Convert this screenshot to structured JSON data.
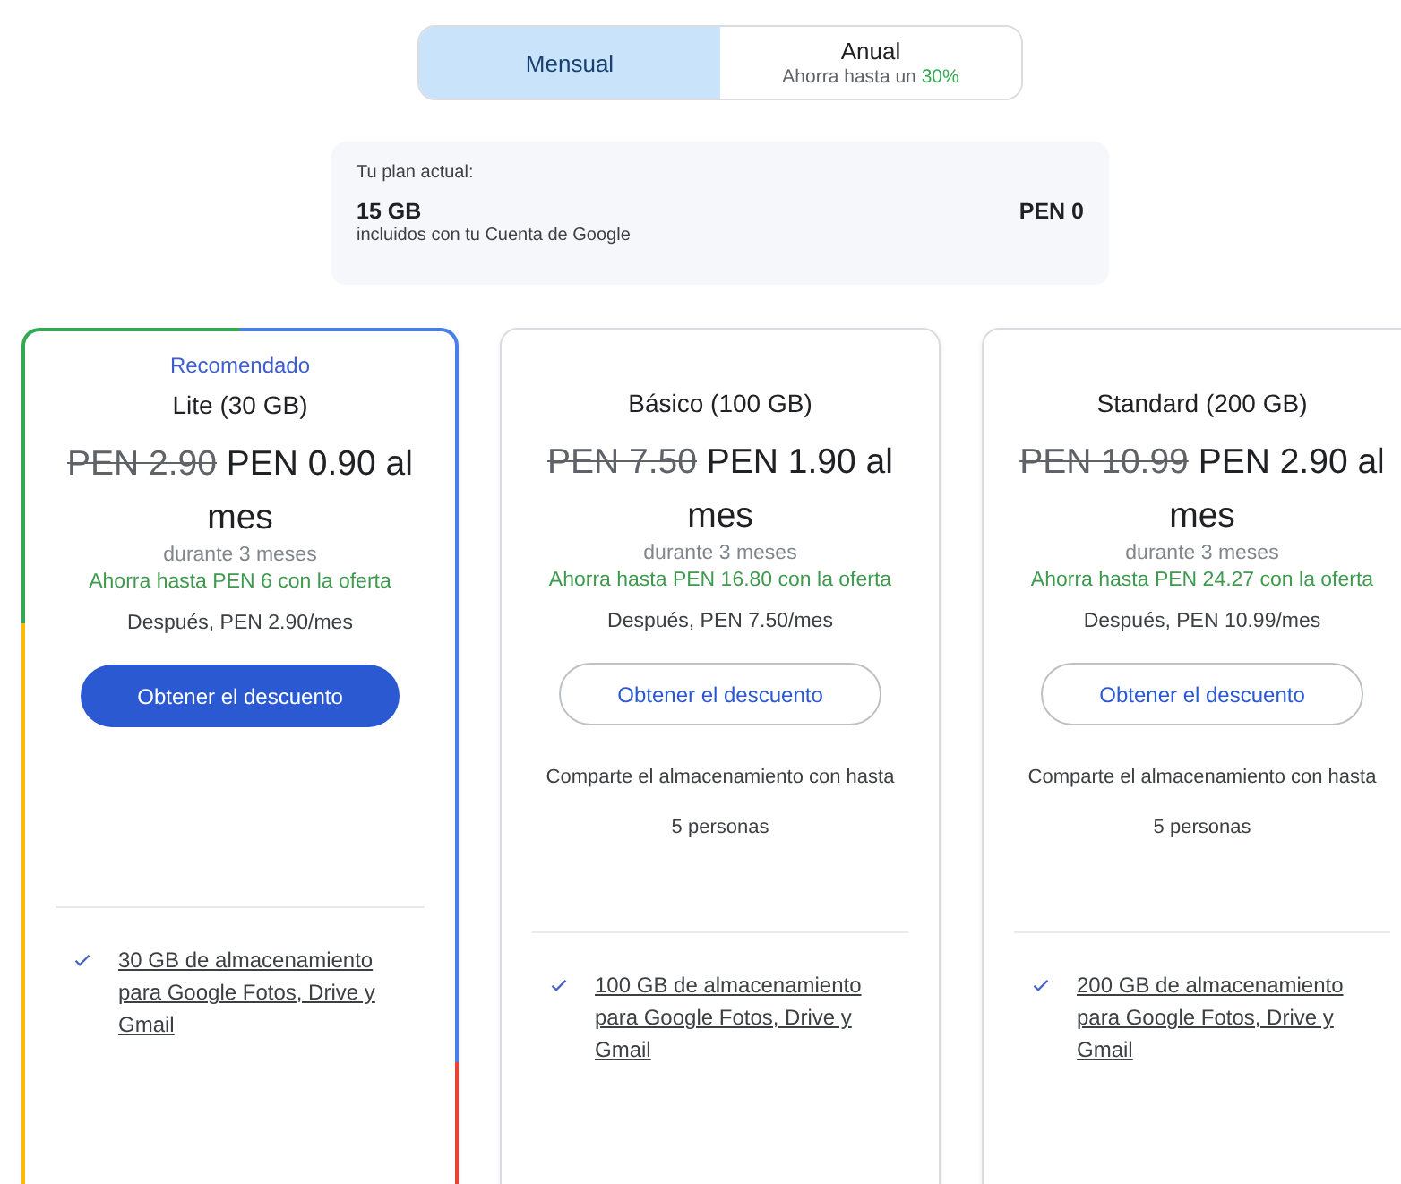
{
  "billing_toggle": [
    {
      "label": "Mensual",
      "selected": true
    },
    {
      "label": "Anual",
      "selected": false,
      "note": "Ahorra hasta un",
      "note_highlight": "30%"
    }
  ],
  "current_plan": {
    "caption": "Tu plan actual:",
    "size": "15 GB",
    "description": "incluidos con tu Cuenta de Google",
    "price": "PEN 0"
  },
  "plans": [
    {
      "recommended": true,
      "badge": "Recomendado",
      "name": "Lite (30 GB)",
      "old_price": "PEN 2.90",
      "new_price": "PEN 0.90 al mes",
      "duration": "durante 3 meses",
      "savings": "Ahorra hasta PEN 6 con la oferta",
      "after": "Después, PEN 2.90/mes",
      "button": "Obtener el descuento",
      "feature": "30 GB de almacenamiento para Google Fotos, Drive y Gmail"
    },
    {
      "recommended": false,
      "name": "Básico (100 GB)",
      "old_price": "PEN 7.50",
      "new_price": "PEN 1.90 al mes",
      "duration": "durante 3 meses",
      "savings": "Ahorra hasta PEN 16.80 con la oferta",
      "after": "Después, PEN 7.50/mes",
      "button": "Obtener el descuento",
      "share": "Comparte el almacenamiento con hasta 5 personas",
      "feature": "100 GB de almacenamiento para Google Fotos, Drive y Gmail"
    },
    {
      "recommended": false,
      "name": "Standard (200 GB)",
      "old_price": "PEN 10.99",
      "new_price": "PEN 2.90 al mes",
      "duration": "durante 3 meses",
      "savings": "Ahorra hasta PEN 24.27 con la oferta",
      "after": "Después, PEN 10.99/mes",
      "button": "Obtener el descuento",
      "share": "Comparte el almacenamiento con hasta 5 personas",
      "feature": "200 GB de almacenamiento para Google Fotos, Drive y Gmail"
    }
  ]
}
